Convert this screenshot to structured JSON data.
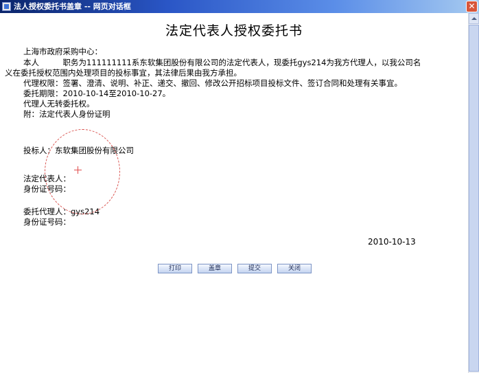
{
  "window": {
    "title": "法人授权委托书盖章 -- 网页对话框",
    "close_label": "✕"
  },
  "document": {
    "heading": "法定代表人授权委托书",
    "recipient": "上海市政府采购中心：",
    "para1_line1": "本人　　　职务为111111111系东软集团股份有限公司的法定代表人，现委托gys214为我方代理人，以我公司名",
    "para1_line2": "义在委托授权范围内处理项目的投标事宜，其法律后果由我方承担。",
    "authority": "代理权限：签署、澄清、说明、补正、递交、撤回、修改公开招标项目投标文件、签订合同和处理有关事宜。",
    "period": "委托期限：2010-10-14至2010-10-27。",
    "no_subdelegation": "代理人无转委托权。",
    "attachment": "附：法定代表人身份证明",
    "bidder": "投标人：东软集团股份有限公司",
    "legal_rep_label": "法定代表人：",
    "legal_rep_id_label": "身份证号码：",
    "agent": "委托代理人：gys214",
    "agent_id_label": "身份证号码：",
    "date": "2010-10-13"
  },
  "buttons": {
    "print": "打印",
    "stamp": "盖章",
    "submit": "提交",
    "close": "关闭"
  },
  "colors": {
    "seal_outline": "#d9534f",
    "titlebar": "#2a56c6"
  }
}
